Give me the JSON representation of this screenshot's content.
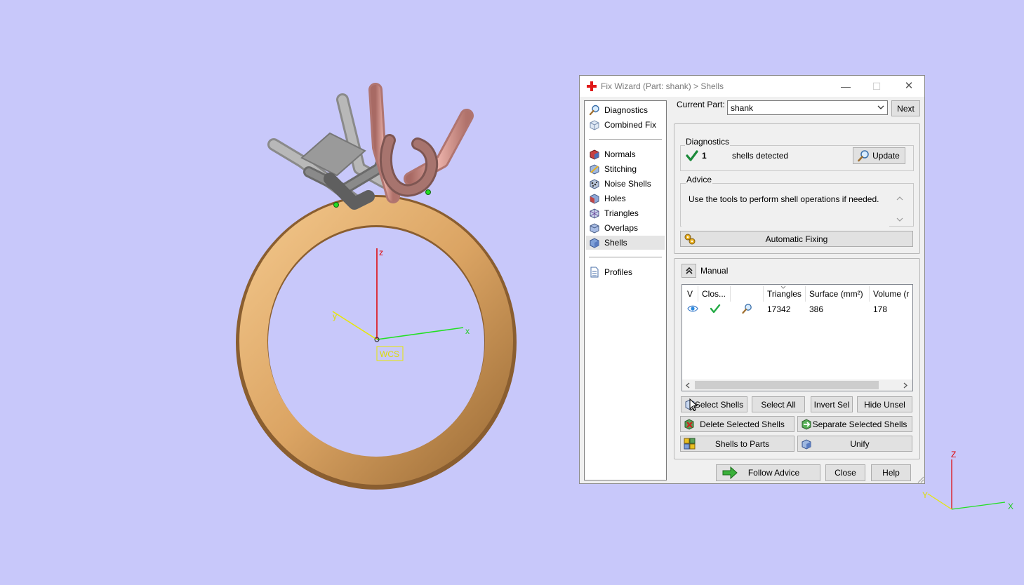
{
  "dialog": {
    "title": "Fix Wizard (Part: shank) > Shells",
    "minimize": "—",
    "maximize": "☐",
    "close": "✕"
  },
  "nav": {
    "items": [
      {
        "label": "Diagnostics",
        "icon": "magnifier-icon"
      },
      {
        "label": "Combined Fix",
        "icon": "combined-fix-icon"
      },
      {
        "label": "Normals",
        "icon": "normals-icon"
      },
      {
        "label": "Stitching",
        "icon": "stitching-icon"
      },
      {
        "label": "Noise Shells",
        "icon": "noise-shells-icon"
      },
      {
        "label": "Holes",
        "icon": "holes-icon"
      },
      {
        "label": "Triangles",
        "icon": "triangles-icon"
      },
      {
        "label": "Overlaps",
        "icon": "overlaps-icon"
      },
      {
        "label": "Shells",
        "icon": "shells-icon"
      },
      {
        "label": "Profiles",
        "icon": "profiles-icon"
      }
    ],
    "selected": "Shells"
  },
  "current_part": {
    "label": "Current Part:",
    "value": "shank",
    "next": "Next"
  },
  "diagnostics": {
    "title": "Diagnostics",
    "count": "1",
    "text": "shells detected",
    "update": "Update"
  },
  "advice": {
    "title": "Advice",
    "text": "Use the tools to perform shell operations if needed."
  },
  "automatic_fixing": "Automatic Fixing",
  "manual": {
    "title": "Manual",
    "columns": [
      "V",
      "Clos...",
      "",
      "Triangles",
      "Surface (mm²)",
      "Volume (r"
    ],
    "row": {
      "triangles": "17342",
      "surface": "386",
      "volume": "178"
    }
  },
  "buttons": {
    "select_shells": "Select Shells",
    "select_all": "Select All",
    "invert_sel": "Invert Sel",
    "hide_unsel": "Hide Unsel",
    "delete_selected": "Delete Selected Shells",
    "separate_selected": "Separate Selected Shells",
    "shells_to_parts": "Shells to Parts",
    "unify": "Unify",
    "follow_advice": "Follow Advice",
    "close": "Close",
    "help": "Help"
  },
  "scene": {
    "wcs_label": "WCS",
    "axis_x": "x",
    "axis_y": "y",
    "axis_z": "z",
    "corner_x": "X",
    "corner_y": "Y",
    "corner_z": "Z",
    "colors": {
      "background": "#c8c8fa",
      "ring_gold": "#dba463",
      "prong_silver": "#a8a8a8",
      "prong_rose": "#d9968f"
    }
  }
}
